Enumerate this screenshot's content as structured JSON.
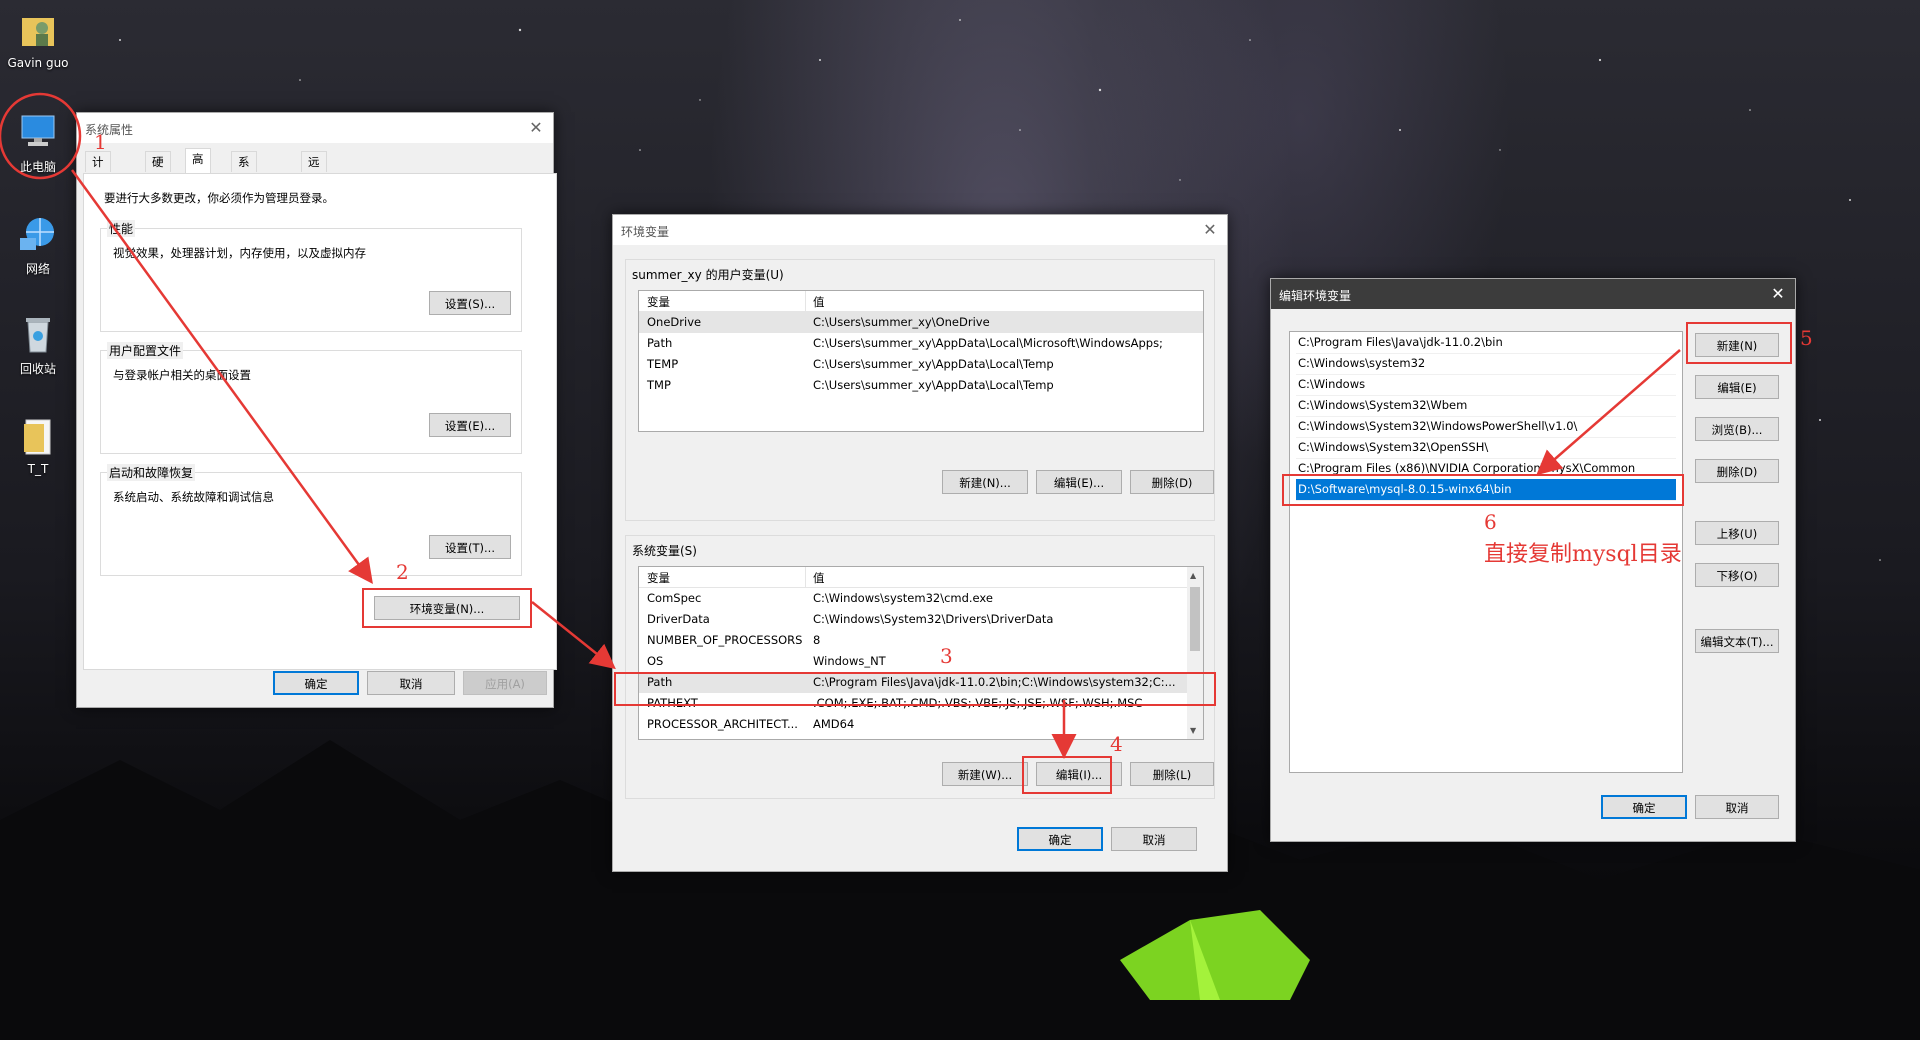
{
  "desktop": {
    "icons": [
      {
        "label": "Gavin guo",
        "icon": "user-folder-icon"
      },
      {
        "label": "此电脑",
        "icon": "computer-icon"
      },
      {
        "label": "网络",
        "icon": "network-icon"
      },
      {
        "label": "回收站",
        "icon": "recycle-bin-icon"
      },
      {
        "label": "T_T",
        "icon": "folder-icon"
      }
    ]
  },
  "system_properties": {
    "title": "系统属性",
    "tabs": [
      "计算机名",
      "硬件",
      "高级",
      "系统保护",
      "远程"
    ],
    "active_tab": "高级",
    "admin_notice": "要进行大多数更改，你必须作为管理员登录。",
    "performance": {
      "label": "性能",
      "desc": "视觉效果，处理器计划，内存使用，以及虚拟内存",
      "button": "设置(S)..."
    },
    "user_profile": {
      "label": "用户配置文件",
      "desc": "与登录帐户相关的桌面设置",
      "button": "设置(E)..."
    },
    "startup": {
      "label": "启动和故障恢复",
      "desc": "系统启动、系统故障和调试信息",
      "button": "设置(T)..."
    },
    "env_button": "环境变量(N)...",
    "ok": "确定",
    "cancel": "取消",
    "apply": "应用(A)"
  },
  "env_vars": {
    "title": "环境变量",
    "user_section": "summer_xy 的用户变量(U)",
    "col_var": "变量",
    "col_val": "值",
    "user_rows": [
      {
        "name": "OneDrive",
        "value": "C:\\Users\\summer_xy\\OneDrive"
      },
      {
        "name": "Path",
        "value": "C:\\Users\\summer_xy\\AppData\\Local\\Microsoft\\WindowsApps;"
      },
      {
        "name": "TEMP",
        "value": "C:\\Users\\summer_xy\\AppData\\Local\\Temp"
      },
      {
        "name": "TMP",
        "value": "C:\\Users\\summer_xy\\AppData\\Local\\Temp"
      }
    ],
    "user_buttons": {
      "new": "新建(N)...",
      "edit": "编辑(E)...",
      "delete": "删除(D)"
    },
    "system_section": "系统变量(S)",
    "system_rows": [
      {
        "name": "ComSpec",
        "value": "C:\\Windows\\system32\\cmd.exe"
      },
      {
        "name": "DriverData",
        "value": "C:\\Windows\\System32\\Drivers\\DriverData"
      },
      {
        "name": "NUMBER_OF_PROCESSORS",
        "value": "8"
      },
      {
        "name": "OS",
        "value": "Windows_NT"
      },
      {
        "name": "Path",
        "value": "C:\\Program Files\\Java\\jdk-11.0.2\\bin;C:\\Windows\\system32;C:..."
      },
      {
        "name": "PATHEXT",
        "value": ".COM;.EXE;.BAT;.CMD;.VBS;.VBE;.JS;.JSE;.WSF;.WSH;.MSC"
      },
      {
        "name": "PROCESSOR_ARCHITECT...",
        "value": "AMD64"
      }
    ],
    "system_buttons": {
      "new": "新建(W)...",
      "edit": "编辑(I)...",
      "delete": "删除(L)"
    },
    "ok": "确定",
    "cancel": "取消"
  },
  "edit_env": {
    "title": "编辑环境变量",
    "rows": [
      "C:\\Program Files\\Java\\jdk-11.0.2\\bin",
      "C:\\Windows\\system32",
      "C:\\Windows",
      "C:\\Windows\\System32\\Wbem",
      "C:\\Windows\\System32\\WindowsPowerShell\\v1.0\\",
      "C:\\Windows\\System32\\OpenSSH\\",
      "C:\\Program Files (x86)\\NVIDIA Corporation\\PhysX\\Common",
      "D:\\Software\\mysql-8.0.15-winx64\\bin"
    ],
    "buttons": {
      "new": "新建(N)",
      "edit": "编辑(E)",
      "browse": "浏览(B)...",
      "delete": "删除(D)",
      "up": "上移(U)",
      "down": "下移(O)",
      "edit_text": "编辑文本(T)..."
    },
    "ok": "确定",
    "cancel": "取消"
  },
  "annotations": {
    "steps": [
      "1",
      "2",
      "3",
      "4",
      "5",
      "6"
    ],
    "note": "直接复制mysql目录"
  },
  "colors": {
    "annotation": "#e53935",
    "selection": "#0078d7"
  }
}
